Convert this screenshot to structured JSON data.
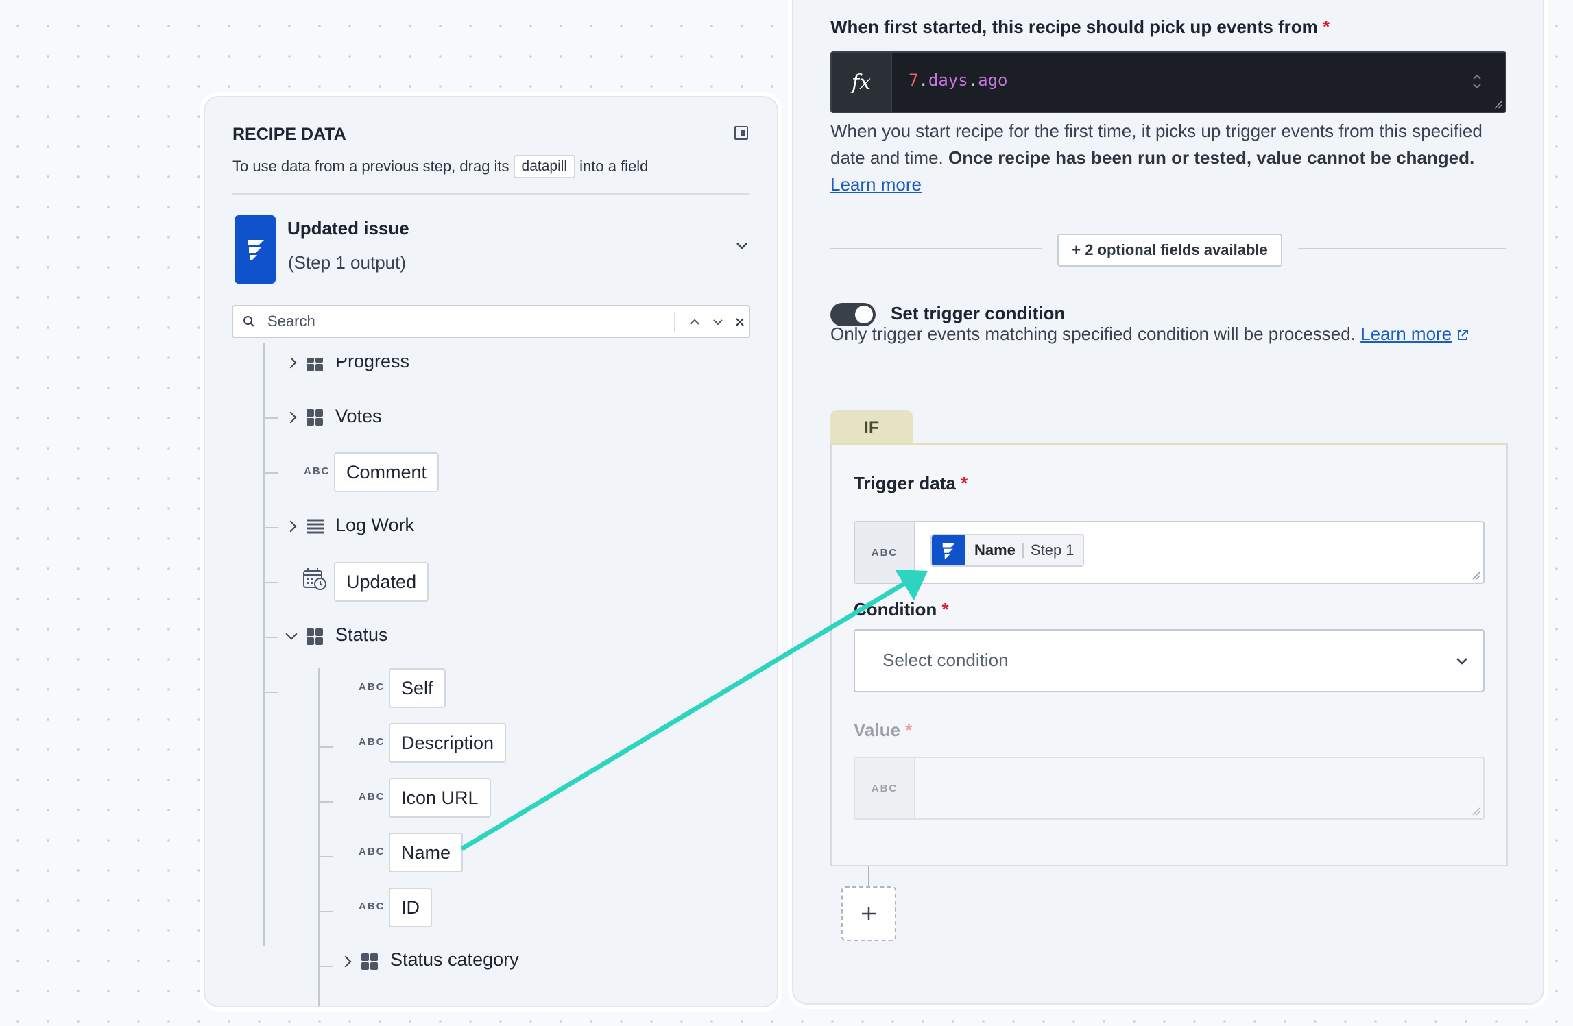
{
  "recipe_data": {
    "title": "RECIPE DATA",
    "hint_before": "To use data from a previous step, drag its",
    "hint_pill": "datapill",
    "hint_after": "into a field",
    "step": {
      "name": "Updated issue",
      "subtitle": "(Step 1 output)"
    },
    "search_placeholder": "Search",
    "type_label": "ABC",
    "tree": {
      "progress": "Progress",
      "votes": "Votes",
      "comment": "Comment",
      "log_work": "Log Work",
      "updated": "Updated",
      "status": "Status",
      "self": "Self",
      "description": "Description",
      "icon_url": "Icon URL",
      "name": "Name",
      "id": "ID",
      "status_category": "Status category"
    }
  },
  "config": {
    "since_label": "When first started, this recipe should pick up events from",
    "required_mark": "*",
    "formula": {
      "number": "7",
      "dot1": ".",
      "part1": "days",
      "dot2": ".",
      "part2": "ago"
    },
    "since_help_normal": "When you start recipe for the first time, it picks up trigger events from this specified date and time.",
    "since_help_bold": "Once recipe has been run or tested, value cannot be changed.",
    "learn_more": "Learn more",
    "optional_fields_button": "+ 2 optional fields available",
    "trigger_condition": {
      "toggle_on": true,
      "label": "Set trigger condition",
      "help": "Only trigger events matching specified condition will be processed.",
      "learn_more": "Learn more"
    },
    "if_tab": "IF",
    "trigger_data": {
      "label": "Trigger data",
      "type": "ABC",
      "pill_name": "Name",
      "pill_step": "Step 1"
    },
    "condition": {
      "label": "Condition",
      "placeholder": "Select condition"
    },
    "value": {
      "label": "Value",
      "type": "ABC"
    }
  },
  "colors": {
    "accent_teal": "#2dd4c0",
    "jira_blue": "#0e52cc",
    "required_red": "#d1242f",
    "link_blue": "#1a5fc0"
  }
}
